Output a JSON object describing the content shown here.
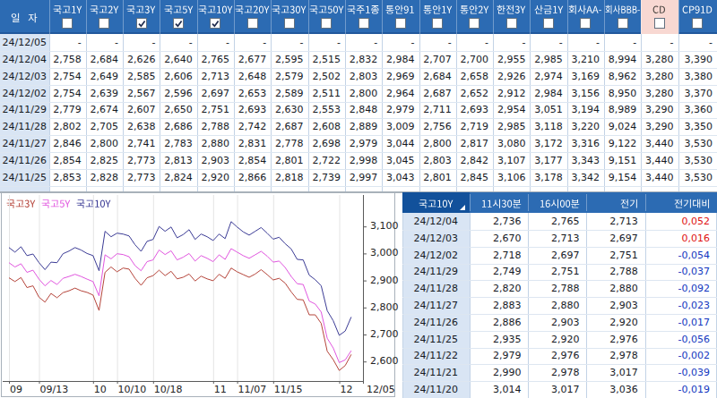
{
  "top_table": {
    "date_header": "일 자",
    "columns": [
      {
        "label": "국고1Y",
        "checked": false,
        "highlight": false
      },
      {
        "label": "국고2Y",
        "checked": false,
        "highlight": false
      },
      {
        "label": "국고3Y",
        "checked": true,
        "highlight": false
      },
      {
        "label": "국고5Y",
        "checked": true,
        "highlight": false
      },
      {
        "label": "국고10Y",
        "checked": true,
        "highlight": false
      },
      {
        "label": "국고20Y",
        "checked": false,
        "highlight": false
      },
      {
        "label": "국고30Y",
        "checked": false,
        "highlight": false
      },
      {
        "label": "국고50Y",
        "checked": false,
        "highlight": false
      },
      {
        "label": "국주1종",
        "checked": false,
        "highlight": false
      },
      {
        "label": "통안91",
        "checked": false,
        "highlight": false
      },
      {
        "label": "통안1Y",
        "checked": false,
        "highlight": false
      },
      {
        "label": "통안2Y",
        "checked": false,
        "highlight": false
      },
      {
        "label": "한전3Y",
        "checked": false,
        "highlight": false
      },
      {
        "label": "산금1Y",
        "checked": false,
        "highlight": false
      },
      {
        "label": "회사AA-",
        "checked": false,
        "highlight": false
      },
      {
        "label": "회사BBB-",
        "checked": false,
        "highlight": false
      },
      {
        "label": "CD",
        "checked": false,
        "highlight": true
      },
      {
        "label": "CP91D",
        "checked": false,
        "highlight": false
      }
    ],
    "rows": [
      {
        "date": "24/12/05",
        "values": [
          "-",
          "-",
          "-",
          "-",
          "-",
          "-",
          "-",
          "-",
          "-",
          "-",
          "-",
          "-",
          "-",
          "-",
          "-",
          "-",
          "-",
          "-"
        ]
      },
      {
        "date": "24/12/04",
        "values": [
          "2,758",
          "2,684",
          "2,626",
          "2,640",
          "2,765",
          "2,677",
          "2,595",
          "2,515",
          "2,832",
          "2,984",
          "2,707",
          "2,700",
          "2,955",
          "2,985",
          "3,210",
          "8,994",
          "3,280",
          "3,390"
        ]
      },
      {
        "date": "24/12/03",
        "values": [
          "2,754",
          "2,649",
          "2,585",
          "2,606",
          "2,713",
          "2,648",
          "2,579",
          "2,502",
          "2,803",
          "2,969",
          "2,684",
          "2,658",
          "2,926",
          "2,974",
          "3,169",
          "8,962",
          "3,280",
          "3,380"
        ]
      },
      {
        "date": "24/12/02",
        "values": [
          "2,754",
          "2,639",
          "2,567",
          "2,596",
          "2,697",
          "2,653",
          "2,589",
          "2,511",
          "2,800",
          "2,964",
          "2,687",
          "2,652",
          "2,912",
          "2,984",
          "3,156",
          "8,950",
          "3,280",
          "3,370"
        ]
      },
      {
        "date": "24/11/29",
        "values": [
          "2,779",
          "2,674",
          "2,607",
          "2,650",
          "2,751",
          "2,693",
          "2,630",
          "2,553",
          "2,848",
          "2,979",
          "2,711",
          "2,693",
          "2,954",
          "3,051",
          "3,194",
          "8,989",
          "3,290",
          "3,360"
        ]
      },
      {
        "date": "24/11/28",
        "values": [
          "2,802",
          "2,705",
          "2,638",
          "2,686",
          "2,788",
          "2,742",
          "2,687",
          "2,608",
          "2,889",
          "3,009",
          "2,756",
          "2,719",
          "2,985",
          "3,118",
          "3,220",
          "9,024",
          "3,290",
          "3,350"
        ]
      },
      {
        "date": "24/11/27",
        "values": [
          "2,846",
          "2,800",
          "2,741",
          "2,783",
          "2,880",
          "2,831",
          "2,778",
          "2,698",
          "2,979",
          "3,044",
          "2,800",
          "2,817",
          "3,080",
          "3,172",
          "3,316",
          "9,122",
          "3,440",
          "3,530"
        ]
      },
      {
        "date": "24/11/26",
        "values": [
          "2,854",
          "2,825",
          "2,773",
          "2,813",
          "2,903",
          "2,854",
          "2,801",
          "2,722",
          "2,998",
          "3,045",
          "2,803",
          "2,842",
          "3,107",
          "3,177",
          "3,343",
          "9,151",
          "3,440",
          "3,530"
        ]
      },
      {
        "date": "24/11/25",
        "values": [
          "2,853",
          "2,828",
          "2,773",
          "2,824",
          "2,920",
          "2,866",
          "2,818",
          "2,739",
          "2,997",
          "3,043",
          "2,801",
          "2,845",
          "3,106",
          "3,178",
          "3,342",
          "9,154",
          "3,440",
          "3,530"
        ]
      }
    ]
  },
  "chart_data": {
    "type": "line",
    "legend": [
      "국고3Y",
      "국고5Y",
      "국고10Y"
    ],
    "legend_position": "top-left",
    "grid": "vertical-only",
    "ylim": [
      2.53,
      3.22
    ],
    "y_ticks": [
      {
        "value": 3.1,
        "label": "3,100"
      },
      {
        "value": 3.0,
        "label": "3,000"
      },
      {
        "value": 2.9,
        "label": "2,900"
      },
      {
        "value": 2.8,
        "label": "2,800"
      },
      {
        "value": 2.7,
        "label": "2,700"
      },
      {
        "value": 2.6,
        "label": "2,600"
      }
    ],
    "x_ticks": [
      {
        "index": 0,
        "label": "09"
      },
      {
        "index": 5,
        "label": "09/13"
      },
      {
        "index": 14,
        "label": "10"
      },
      {
        "index": 18,
        "label": "10/10"
      },
      {
        "index": 24,
        "label": "10/18"
      },
      {
        "index": 34,
        "label": "11"
      },
      {
        "index": 38,
        "label": "11/07"
      },
      {
        "index": 44,
        "label": "11/15"
      },
      {
        "index": 55,
        "label": "12"
      },
      {
        "index": 60,
        "label": "12/05"
      }
    ],
    "series": [
      {
        "name": "국고3Y",
        "color": "#b5443a",
        "values": [
          2.91,
          2.896,
          2.911,
          2.874,
          2.88,
          2.838,
          2.82,
          2.852,
          2.836,
          2.855,
          2.862,
          2.872,
          2.862,
          2.856,
          2.846,
          2.789,
          2.93,
          2.95,
          2.932,
          2.946,
          2.942,
          2.908,
          2.882,
          2.91,
          2.918,
          2.938,
          2.918,
          2.934,
          2.906,
          2.912,
          2.924,
          2.898,
          2.916,
          2.906,
          2.899,
          2.923,
          2.908,
          2.946,
          2.932,
          2.922,
          2.912,
          2.924,
          2.94,
          2.922,
          2.902,
          2.908,
          2.89,
          2.858,
          2.83,
          2.828,
          2.773,
          2.773,
          2.741,
          2.638,
          2.607,
          2.567,
          2.585,
          2.626
        ]
      },
      {
        "name": "국고5Y",
        "color": "#e156df",
        "values": [
          2.966,
          2.95,
          2.962,
          2.93,
          2.938,
          2.905,
          2.88,
          2.9,
          2.885,
          2.908,
          2.915,
          2.923,
          2.915,
          2.905,
          2.896,
          2.843,
          2.995,
          2.98,
          2.999,
          2.996,
          2.988,
          2.955,
          2.936,
          2.97,
          2.976,
          3.013,
          2.996,
          3.01,
          2.976,
          2.986,
          3.0,
          2.972,
          2.992,
          2.982,
          2.97,
          2.995,
          2.978,
          3.018,
          3.005,
          2.992,
          2.982,
          2.995,
          3.008,
          2.99,
          2.968,
          2.972,
          2.948,
          2.915,
          2.888,
          2.885,
          2.824,
          2.813,
          2.783,
          2.686,
          2.65,
          2.596,
          2.606,
          2.64
        ]
      },
      {
        "name": "국고10Y",
        "color": "#3b3b95",
        "values": [
          3.022,
          3.005,
          3.025,
          2.992,
          2.998,
          2.966,
          2.94,
          2.968,
          2.966,
          2.999,
          3.009,
          3.022,
          3.013,
          3.0,
          2.992,
          2.936,
          3.082,
          3.062,
          3.075,
          3.072,
          3.065,
          3.032,
          3.008,
          3.045,
          3.052,
          3.1,
          3.082,
          3.098,
          3.058,
          3.07,
          3.088,
          3.052,
          3.072,
          3.062,
          3.048,
          3.072,
          3.055,
          3.118,
          3.098,
          3.08,
          3.068,
          3.082,
          3.096,
          3.075,
          3.053,
          3.06,
          3.036,
          3.017,
          2.978,
          2.976,
          2.92,
          2.903,
          2.88,
          2.788,
          2.751,
          2.697,
          2.713,
          2.765
        ]
      }
    ]
  },
  "right_table": {
    "sort_header": "국고10Y",
    "headers": [
      "11시30분",
      "16시00분",
      "전기",
      "전기대비"
    ],
    "change_colors": {
      "up": "#e01111",
      "down": "#1236c0"
    },
    "rows": [
      {
        "date": "24/12/04",
        "t1130": "2,736",
        "t1600": "2,765",
        "prev": "2,713",
        "change": "0,052",
        "direction": "up"
      },
      {
        "date": "24/12/03",
        "t1130": "2,670",
        "t1600": "2,713",
        "prev": "2,697",
        "change": "0,016",
        "direction": "up"
      },
      {
        "date": "24/12/02",
        "t1130": "2,718",
        "t1600": "2,697",
        "prev": "2,751",
        "change": "-0,054",
        "direction": "down"
      },
      {
        "date": "24/11/29",
        "t1130": "2,749",
        "t1600": "2,751",
        "prev": "2,788",
        "change": "-0,037",
        "direction": "down"
      },
      {
        "date": "24/11/28",
        "t1130": "2,820",
        "t1600": "2,788",
        "prev": "2,880",
        "change": "-0,092",
        "direction": "down"
      },
      {
        "date": "24/11/27",
        "t1130": "2,883",
        "t1600": "2,880",
        "prev": "2,903",
        "change": "-0,023",
        "direction": "down"
      },
      {
        "date": "24/11/26",
        "t1130": "2,886",
        "t1600": "2,903",
        "prev": "2,920",
        "change": "-0,017",
        "direction": "down"
      },
      {
        "date": "24/11/25",
        "t1130": "2,935",
        "t1600": "2,920",
        "prev": "2,976",
        "change": "-0,056",
        "direction": "down"
      },
      {
        "date": "24/11/22",
        "t1130": "2,979",
        "t1600": "2,976",
        "prev": "2,978",
        "change": "-0,002",
        "direction": "down"
      },
      {
        "date": "24/11/21",
        "t1130": "2,990",
        "t1600": "2,978",
        "prev": "3,017",
        "change": "-0,039",
        "direction": "down"
      },
      {
        "date": "24/11/20",
        "t1130": "3,014",
        "t1600": "3,017",
        "prev": "3,036",
        "change": "-0,019",
        "direction": "down"
      }
    ]
  },
  "colors": {
    "header_blue": "#2c6bb3",
    "header_blue_dark": "#12519b",
    "highlight_pink": "#f8d8d2",
    "date_cell_bg": "#d9e5f4",
    "grid_vertical": "#c3d3e6",
    "grid_horizontal": "#dde6f1",
    "panel_border": "#a8b1ba",
    "text": "#15191f"
  }
}
